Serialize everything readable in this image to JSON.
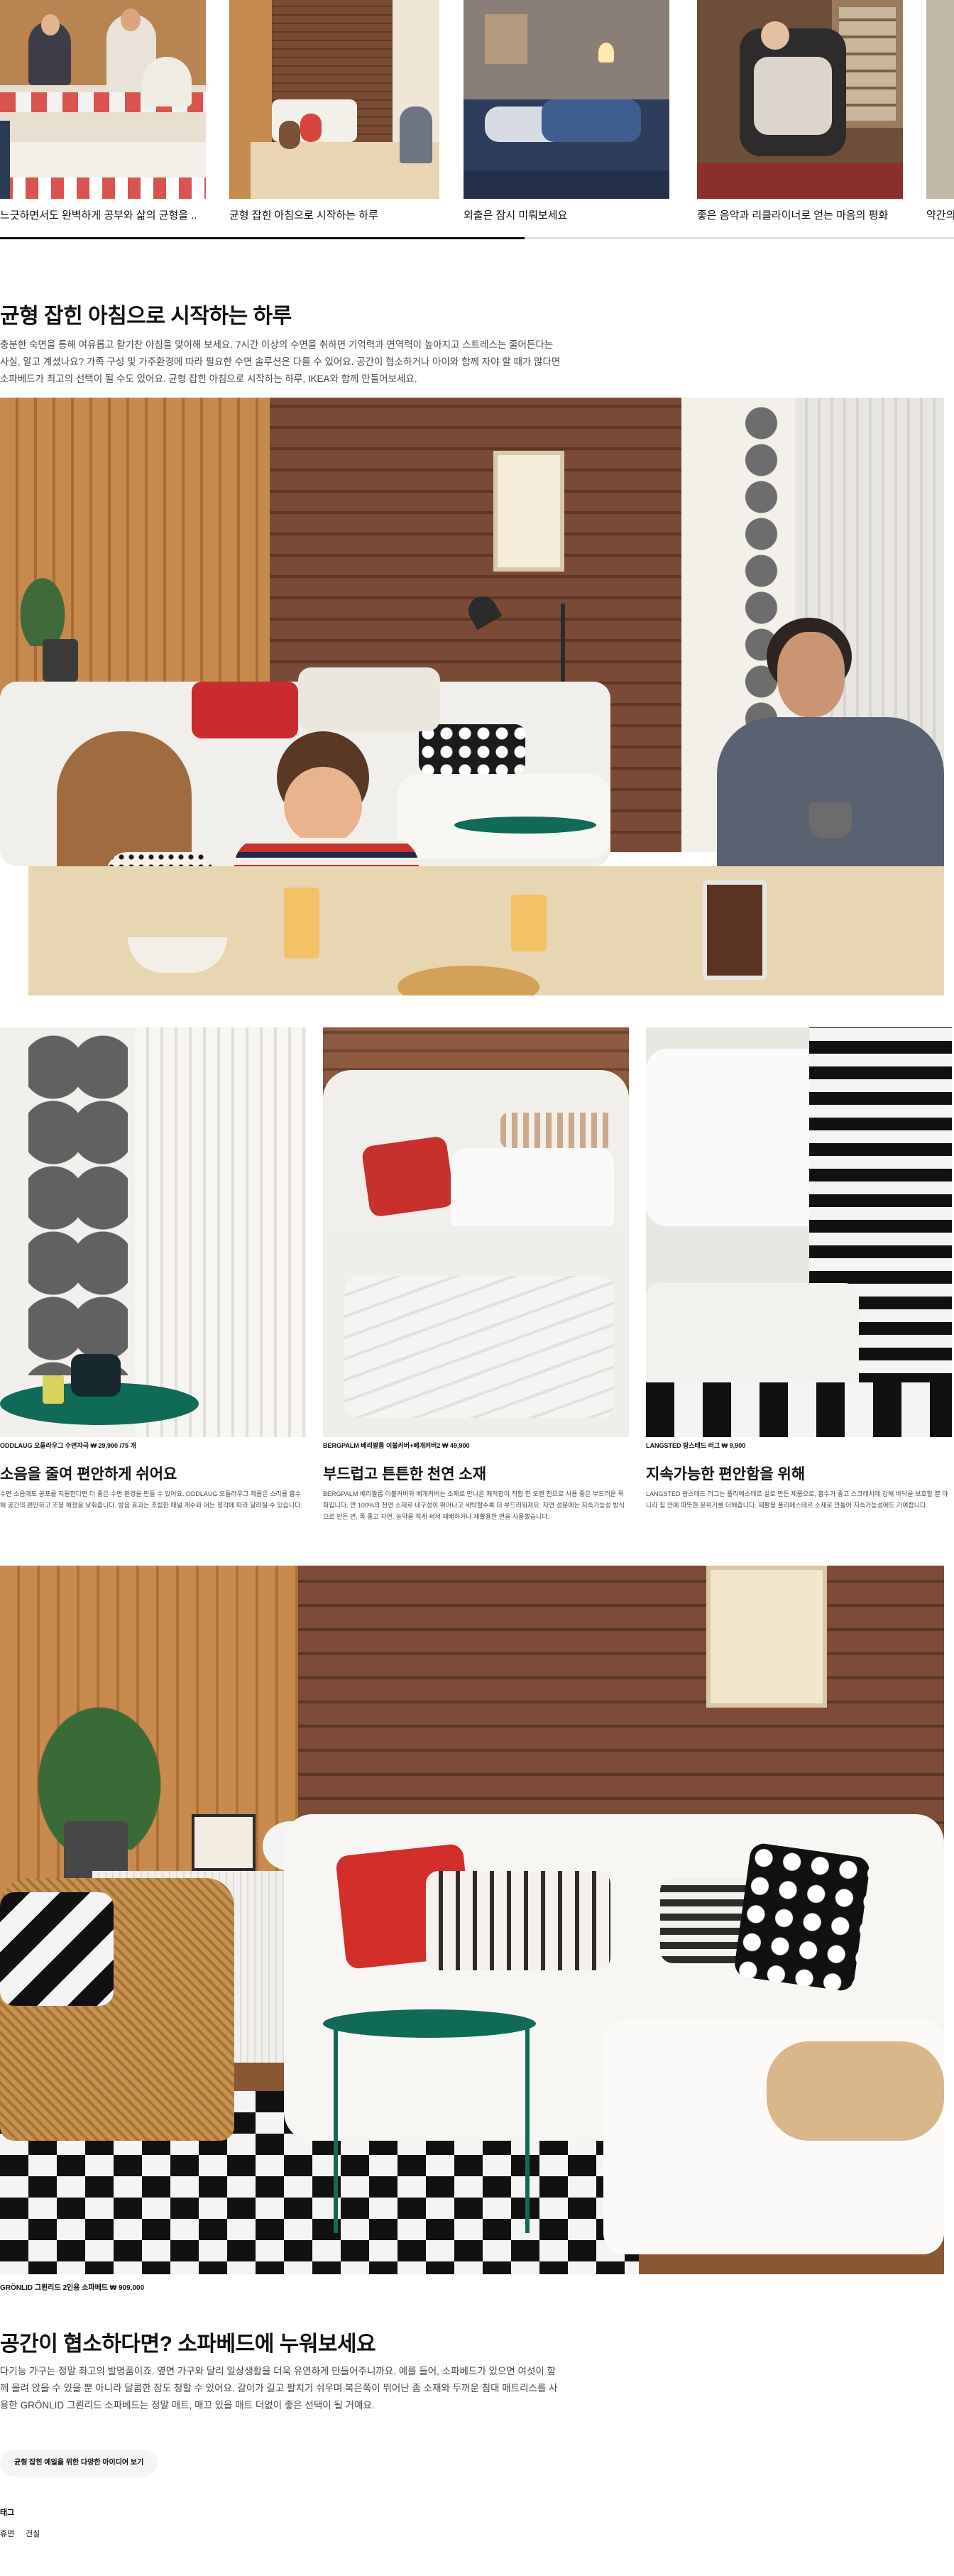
{
  "carousel": {
    "items": [
      {
        "label": "느긋하면서도 완벽하게 공부와 삶의 균형을 .."
      },
      {
        "label": "균형 잡힌 아침으로 시작하는 하루"
      },
      {
        "label": "외출은 잠시 미뤄보세요"
      },
      {
        "label": "좋은 음악과 리클라이너로 얻는 마음의 평화"
      },
      {
        "label": "약간의"
      }
    ],
    "progress": 0.55
  },
  "section1": {
    "title": "균형 잡힌 아침으로 시작하는 하루",
    "body": "충분한 숙면을 통해 여유롭고 활기찬 아침을 맞이해 보세요. 7시간 이상의 수면을 취하면 기억력과 면역력이 높아지고 스트레스는 줄어든다는 사실, 알고 계셨나요? 가족 구성 및 가주환경에 따라 필요한 수면 솔루션은 다를 수 있어요. 공간이 협소하거나 아이와 함께 자야 할 때가 많다면 소파베드가 최고의 선택이 될 수도 있어요. 균형 잡힌 아침으로 시작하는 하루, IKEA와 함께 만들어보세요."
  },
  "cards": [
    {
      "product": "ODDLAUG 오들라우그 수면자극 ₩ 29,900 /75 개",
      "title": "소음을 줄여 편안하게 쉬어요",
      "text": "수면 소음에도 공포를 지원한다면 더 좋은 수면 환경을 만들 수 있어요. ODDLAUG 오들라우그 제품은 소리를 흡수해 공간의 편안하고 조용 해졌을 낮춰줍니다. 방음 효과는 조립한 패널 개수와 어는 정각에 따라 달라질 수 있습니다."
    },
    {
      "product": "BERGPALM 베리팔름 이불커버+베개커버2 ₩ 49,900",
      "title": "부드럽고 튼튼한 천연 소재",
      "text": "BERGPALM 베리팔름 이불커버와 베개커버는 소재로 만나온 쾌적함이 적합 한 오랜 천으로 사용 좋은 부드러운 목화입니다. 면 100%의 천연 소재로 내구성이 뛰어나고 세탁할수록 더 부드러워져요. 자연 성분에는 지속가능성 방식으로 만든 면, 폭 좋고 자연, 농약을 적게 써서 재배하거나 재활용한 면을 사용했습니다."
    },
    {
      "product": "LANGSTED 랑스테드 러그 ₩ 9,900",
      "title": "지속가능한 편안함을 위해",
      "text": "LANGSTED 랑스테드 러그는 폴리에스테르 실로 만든 제품으로, 흡수가 좋고 스크래치에 강해 바닥을 보호할 뿐 아니라 집 안에 따뜻한 분위기를 더해줍니다. 재활용 폴리에스테르 소재로 만들어 지속가능성에도 기여합니다."
    }
  ],
  "section2": {
    "product": "GRÖNLID 그뢴리드 2인용 소파베드 ₩ 909,000",
    "title": "공간이 협소하다면? 소파베드에 누워보세요",
    "body": "다기능 가구는 정말 최고의 발명품이죠. 옆면 가구와 달리 일상생활을 더욱 유연하게 만들어주니까요. 예를 들어, 소파베드가 있으면 여섯이 함께 몰려 앉을 수 있을 뿐 아니라 달콤한 잠도 청할 수 있어요. 갈이가 길고 팔치기 쉬우며 복은쪽이 뛰어난 좀 소재와 두꺼운 침대 매트리스를 사용한 GRÖNLID 그뢴리드 소파베드는 정말 매트, 매끄 있을 매트 더없이 좋은 선택이 될 거예요.",
    "cta": "균형 잡힌 예일을 위한 다양한 아이디어 보기"
  },
  "footer": {
    "heading": "태그",
    "tags": [
      "휴면",
      "건실"
    ]
  },
  "colors": {
    "accent_yellow": "#ffdb00",
    "text": "#111111",
    "muted": "#484848"
  }
}
